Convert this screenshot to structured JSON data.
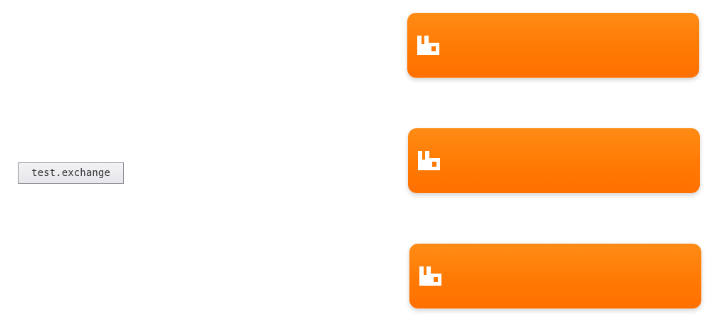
{
  "diagram": {
    "exchange": {
      "label": "test.exchange"
    },
    "nodes": [
      {
        "icon": "rabbitmq-logo-icon",
        "color": "#ff7d09"
      },
      {
        "icon": "rabbitmq-logo-icon",
        "color": "#ff7d09"
      },
      {
        "icon": "rabbitmq-logo-icon",
        "color": "#ff7d09"
      }
    ]
  }
}
